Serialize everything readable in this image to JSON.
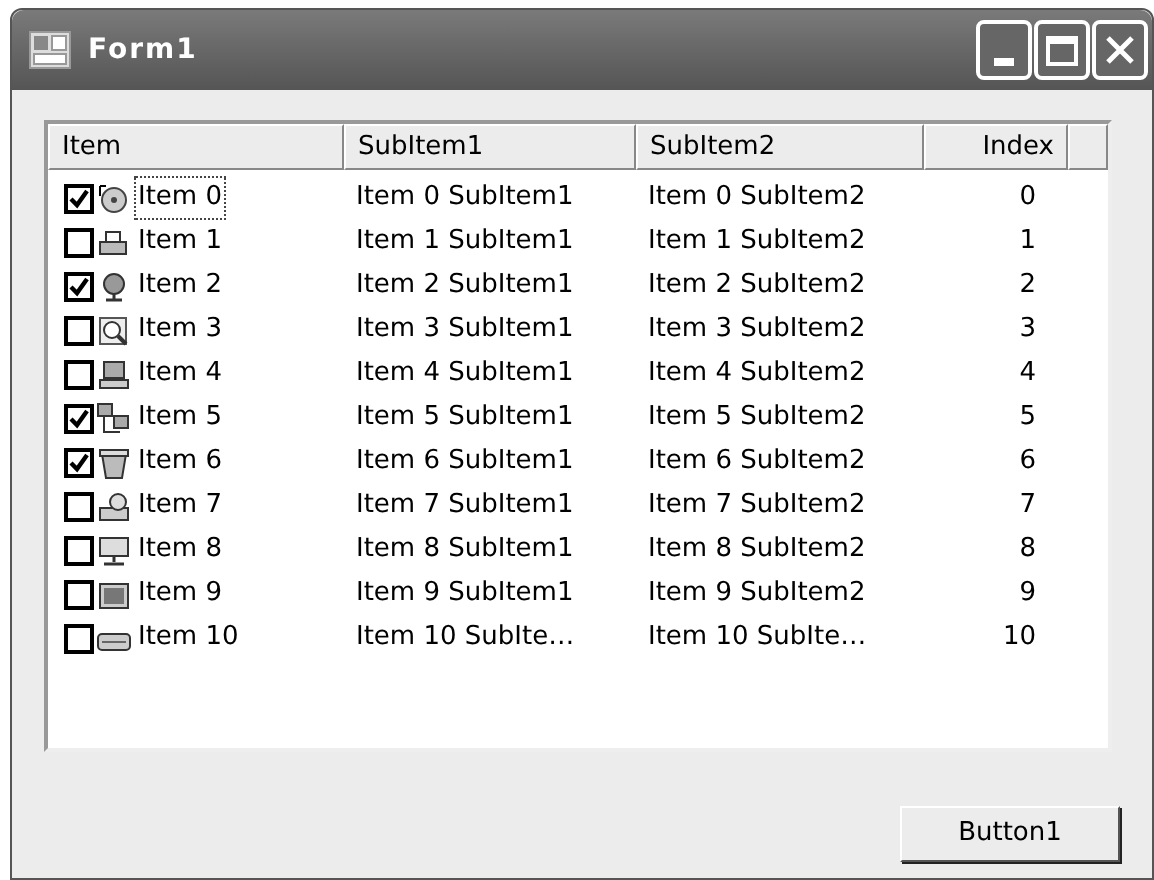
{
  "window": {
    "title": "Form1"
  },
  "list": {
    "columns": [
      {
        "label": "Item",
        "kind": "text"
      },
      {
        "label": "SubItem1",
        "kind": "text"
      },
      {
        "label": "SubItem2",
        "kind": "text"
      },
      {
        "label": "Index",
        "kind": "number"
      }
    ],
    "rows": [
      {
        "checked": true,
        "focused": true,
        "cells": [
          "Item 0",
          "Item 0 SubItem1",
          "Item 0 SubItem2",
          "0"
        ]
      },
      {
        "checked": false,
        "focused": false,
        "cells": [
          "Item 1",
          "Item 1 SubItem1",
          "Item 1 SubItem2",
          "1"
        ]
      },
      {
        "checked": true,
        "focused": false,
        "cells": [
          "Item 2",
          "Item 2 SubItem1",
          "Item 2 SubItem2",
          "2"
        ]
      },
      {
        "checked": false,
        "focused": false,
        "cells": [
          "Item 3",
          "Item 3 SubItem1",
          "Item 3 SubItem2",
          "3"
        ]
      },
      {
        "checked": false,
        "focused": false,
        "cells": [
          "Item 4",
          "Item 4 SubItem1",
          "Item 4 SubItem2",
          "4"
        ]
      },
      {
        "checked": true,
        "focused": false,
        "cells": [
          "Item 5",
          "Item 5 SubItem1",
          "Item 5 SubItem2",
          "5"
        ]
      },
      {
        "checked": true,
        "focused": false,
        "cells": [
          "Item 6",
          "Item 6 SubItem1",
          "Item 6 SubItem2",
          "6"
        ]
      },
      {
        "checked": false,
        "focused": false,
        "cells": [
          "Item 7",
          "Item 7 SubItem1",
          "Item 7 SubItem2",
          "7"
        ]
      },
      {
        "checked": false,
        "focused": false,
        "cells": [
          "Item 8",
          "Item 8 SubItem1",
          "Item 8 SubItem2",
          "8"
        ]
      },
      {
        "checked": false,
        "focused": false,
        "cells": [
          "Item 9",
          "Item 9 SubItem1",
          "Item 9 SubItem2",
          "9"
        ]
      },
      {
        "checked": false,
        "focused": false,
        "cells": [
          "Item 10",
          "Item 10 SubIte…",
          "Item 10 SubIte…",
          "10"
        ]
      }
    ]
  },
  "button": {
    "label": "Button1"
  }
}
